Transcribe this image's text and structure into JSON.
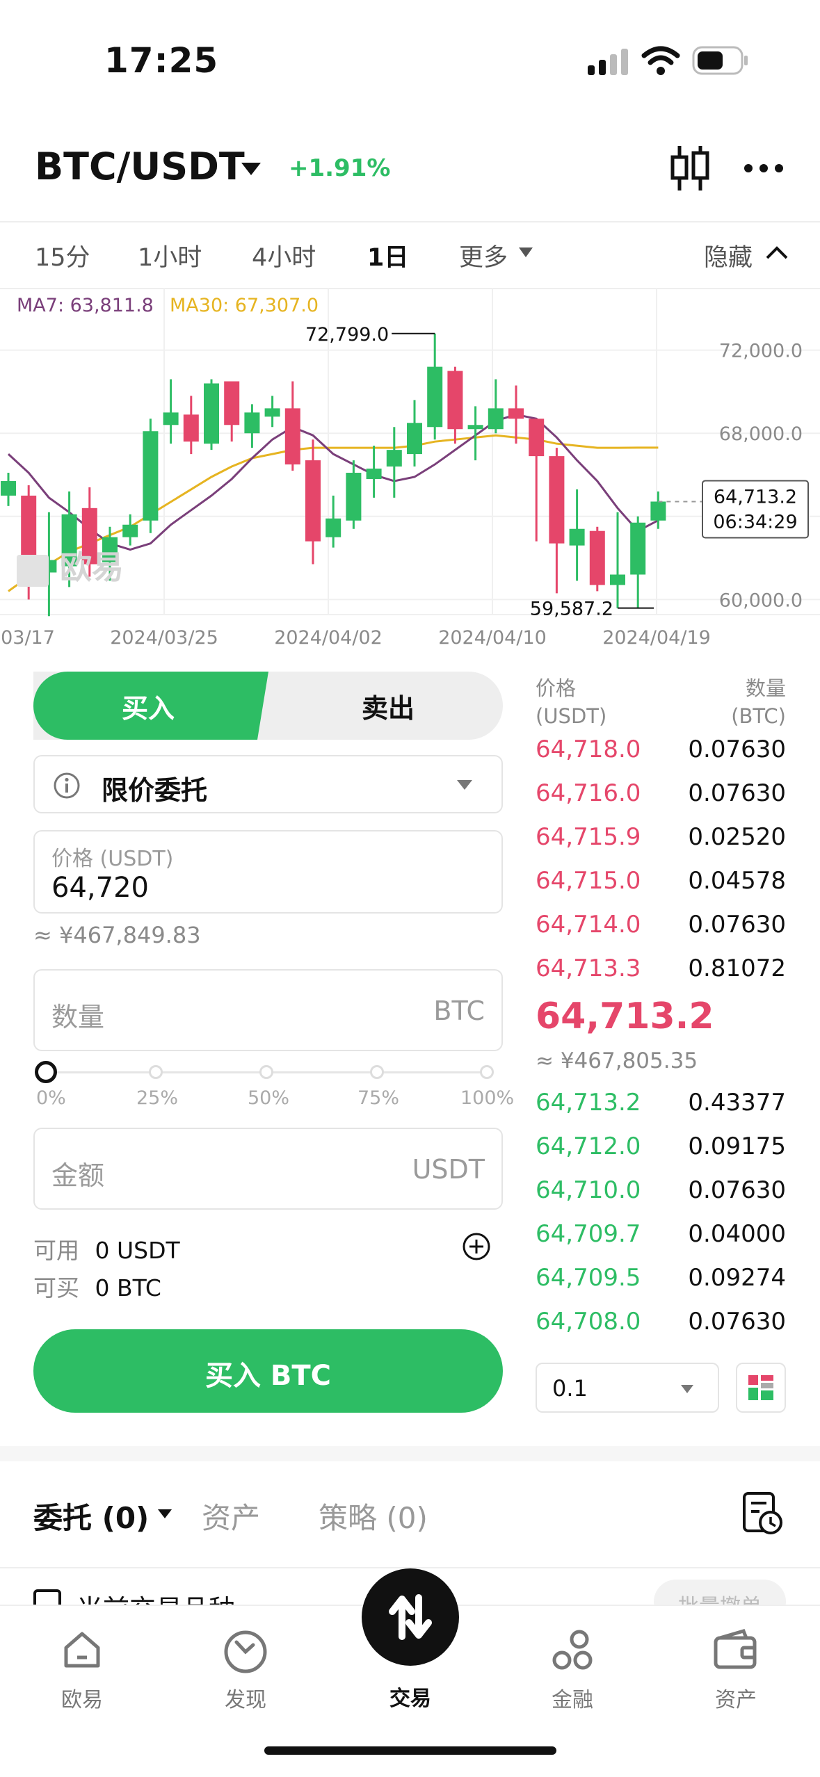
{
  "status": {
    "time": "17:25"
  },
  "header": {
    "pair": "BTC/USDT",
    "change": "+1.91%"
  },
  "intervals": {
    "items": [
      "15分",
      "1小时",
      "4小时",
      "1日",
      "更多"
    ],
    "active": "1日",
    "hide": "隐藏"
  },
  "chart": {
    "ma7": "MA7: 63,811.8",
    "ma30": "MA30: 67,307.0",
    "high_label": "72,799.0",
    "low_label": "59,587.2",
    "y_ticks": [
      "72,000.0",
      "68,000.0",
      "60,000.0"
    ],
    "x_ticks": [
      "03/17",
      "2024/03/25",
      "2024/04/02",
      "2024/04/10",
      "2024/04/19"
    ],
    "last_price": "64,713.2",
    "countdown": "06:34:29",
    "watermark": "欧易",
    "colors": {
      "up": "#2dbd64",
      "down": "#e5466a",
      "ma7": "#7a3f7a",
      "ma30": "#e6b421"
    }
  },
  "chart_data": {
    "type": "candlestick",
    "y_axis_ticks": [
      72000,
      68000,
      60000
    ],
    "x_axis_ticks": [
      "03/17",
      "2024/03/25",
      "2024/04/02",
      "2024/04/10",
      "2024/04/19"
    ],
    "candles": [
      {
        "o": 65000,
        "c": 65700,
        "h": 66100,
        "l": 64500
      },
      {
        "o": 65000,
        "c": 61300,
        "h": 65500,
        "l": 60000
      },
      {
        "o": 61300,
        "c": 61900,
        "h": 64200,
        "l": 59200
      },
      {
        "o": 61600,
        "c": 64100,
        "h": 65200,
        "l": 60600
      },
      {
        "o": 64400,
        "c": 61700,
        "h": 65400,
        "l": 61100
      },
      {
        "o": 61800,
        "c": 63000,
        "h": 63500,
        "l": 60900
      },
      {
        "o": 63000,
        "c": 63600,
        "h": 64100,
        "l": 62600
      },
      {
        "o": 63800,
        "c": 68100,
        "h": 68700,
        "l": 63200
      },
      {
        "o": 68400,
        "c": 69000,
        "h": 70600,
        "l": 67500
      },
      {
        "o": 68900,
        "c": 67600,
        "h": 69800,
        "l": 67000
      },
      {
        "o": 67500,
        "c": 70400,
        "h": 70600,
        "l": 67200
      },
      {
        "o": 70500,
        "c": 68400,
        "h": 70500,
        "l": 67600
      },
      {
        "o": 68000,
        "c": 69000,
        "h": 69400,
        "l": 67300
      },
      {
        "o": 68800,
        "c": 69200,
        "h": 69800,
        "l": 68300
      },
      {
        "o": 69200,
        "c": 66500,
        "h": 70500,
        "l": 66200
      },
      {
        "o": 66700,
        "c": 62800,
        "h": 67700,
        "l": 61700
      },
      {
        "o": 63000,
        "c": 63900,
        "h": 65000,
        "l": 62500
      },
      {
        "o": 63800,
        "c": 66100,
        "h": 66700,
        "l": 63400
      },
      {
        "o": 65800,
        "c": 66300,
        "h": 67400,
        "l": 64900
      },
      {
        "o": 66400,
        "c": 67200,
        "h": 68300,
        "l": 64900
      },
      {
        "o": 67000,
        "c": 68500,
        "h": 69600,
        "l": 66400
      },
      {
        "o": 68300,
        "c": 71200,
        "h": 72799,
        "l": 67700
      },
      {
        "o": 71000,
        "c": 68200,
        "h": 71200,
        "l": 67500
      },
      {
        "o": 68200,
        "c": 68400,
        "h": 69300,
        "l": 66700
      },
      {
        "o": 68200,
        "c": 69200,
        "h": 70600,
        "l": 68000
      },
      {
        "o": 69200,
        "c": 68700,
        "h": 70300,
        "l": 67500
      },
      {
        "o": 68700,
        "c": 66900,
        "h": 68700,
        "l": 62800
      },
      {
        "o": 66900,
        "c": 62700,
        "h": 67300,
        "l": 60300
      },
      {
        "o": 62600,
        "c": 63400,
        "h": 65300,
        "l": 60900
      },
      {
        "o": 63300,
        "c": 60700,
        "h": 63500,
        "l": 60400
      },
      {
        "o": 60700,
        "c": 61200,
        "h": 64200,
        "l": 59587.2
      },
      {
        "o": 61200,
        "c": 63700,
        "h": 64000,
        "l": 59600
      },
      {
        "o": 63800,
        "c": 64713.2,
        "h": 65200,
        "l": 63400
      }
    ],
    "ma7": [
      67000,
      66100,
      64900,
      64200,
      63400,
      62700,
      62400,
      62700,
      63600,
      64300,
      65000,
      65800,
      66800,
      67700,
      68300,
      67900,
      67000,
      66500,
      66000,
      65700,
      65900,
      66500,
      67200,
      67900,
      68600,
      68900,
      68700,
      67800,
      66700,
      65700,
      64400,
      63300,
      63812
    ],
    "ma30": [
      60400,
      61100,
      61700,
      62300,
      62700,
      63100,
      63500,
      64100,
      64700,
      65300,
      65900,
      66400,
      66800,
      67000,
      67200,
      67300,
      67300,
      67300,
      67300,
      67300,
      67400,
      67600,
      67700,
      67800,
      67900,
      67800,
      67700,
      67500,
      67400,
      67300,
      67300,
      67307,
      67307
    ]
  },
  "trade": {
    "buy": "买入",
    "sell": "卖出",
    "order_type": "限价委托",
    "price_label": "价格 (USDT)",
    "price_value": "64,720",
    "price_cny": "≈ ¥467,849.83",
    "qty_placeholder": "数量",
    "qty_unit": "BTC",
    "slider_marks": [
      "0%",
      "25%",
      "50%",
      "75%",
      "100%"
    ],
    "amount_placeholder": "金额",
    "amount_unit": "USDT",
    "avail_label": "可用",
    "avail_value": "0 USDT",
    "canbuy_label": "可买",
    "canbuy_value": "0 BTC",
    "submit": "买入 BTC"
  },
  "orderbook": {
    "price_header_1": "价格",
    "price_header_2": "(USDT)",
    "qty_header_1": "数量",
    "qty_header_2": "(BTC)",
    "asks": [
      {
        "price": "64,718.0",
        "qty": "0.07630"
      },
      {
        "price": "64,716.0",
        "qty": "0.07630"
      },
      {
        "price": "64,715.9",
        "qty": "0.02520"
      },
      {
        "price": "64,715.0",
        "qty": "0.04578"
      },
      {
        "price": "64,714.0",
        "qty": "0.07630"
      },
      {
        "price": "64,713.3",
        "qty": "0.81072"
      }
    ],
    "last": "64,713.2",
    "last_cny": "≈ ¥467,805.35",
    "bids": [
      {
        "price": "64,713.2",
        "qty": "0.43377"
      },
      {
        "price": "64,712.0",
        "qty": "0.09175"
      },
      {
        "price": "64,710.0",
        "qty": "0.07630"
      },
      {
        "price": "64,709.7",
        "qty": "0.04000"
      },
      {
        "price": "64,709.5",
        "qty": "0.09274"
      },
      {
        "price": "64,708.0",
        "qty": "0.07630"
      }
    ],
    "depth": "0.1"
  },
  "orders": {
    "tab_orders": "委托 (0)",
    "tab_assets": "资产",
    "tab_strategy": "策略 (0)",
    "filter_label": "当前交易品种",
    "batch_cancel": "批量撤单"
  },
  "nav": {
    "items": [
      "欧易",
      "发现",
      "交易",
      "金融",
      "资产"
    ],
    "active": "交易"
  }
}
